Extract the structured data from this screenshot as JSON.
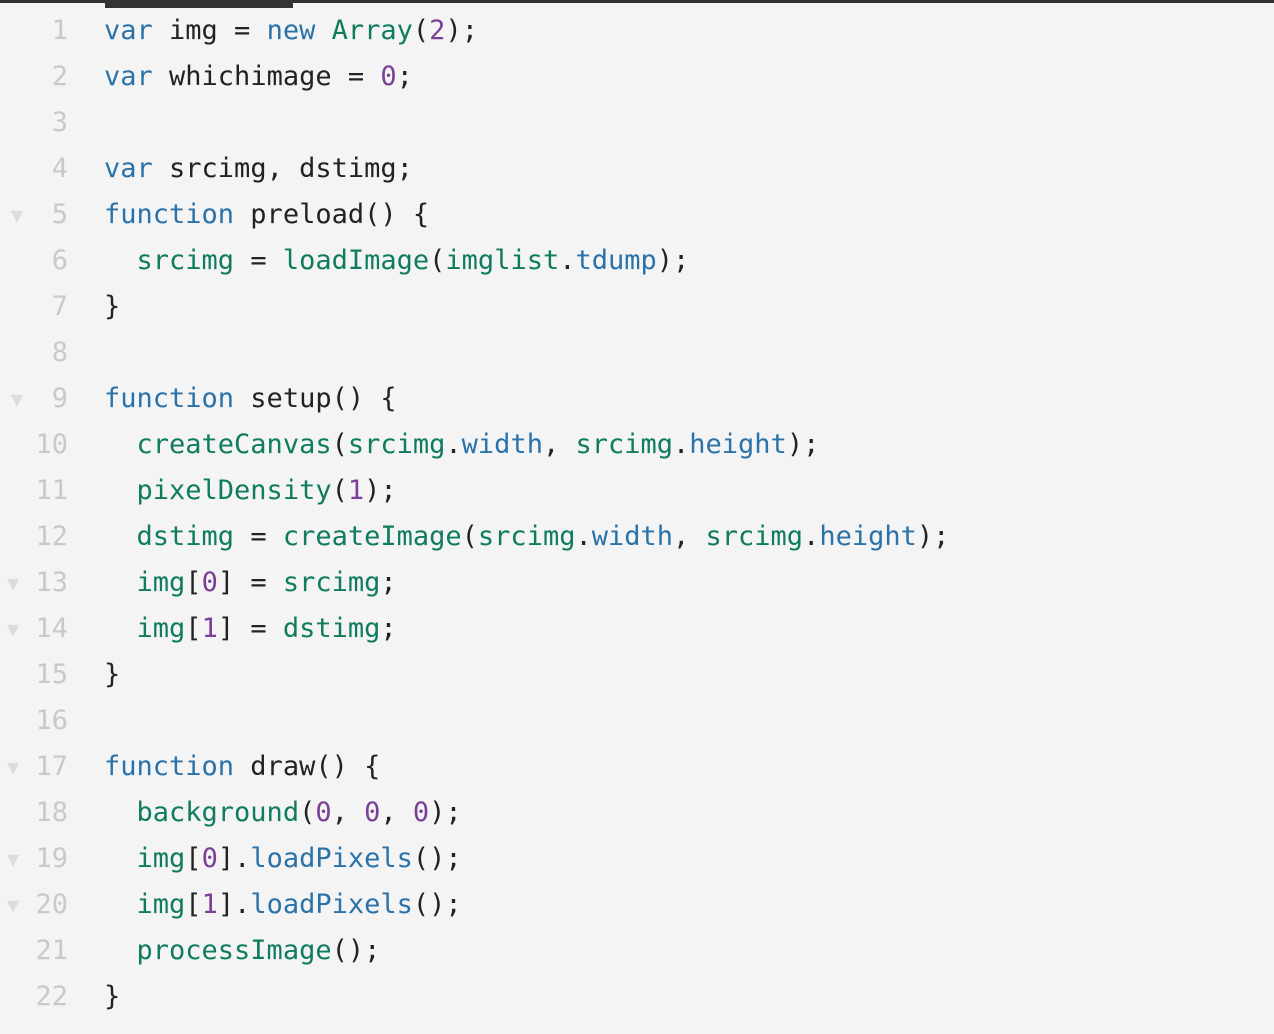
{
  "app": {
    "kind": "code-editor",
    "language": "javascript"
  },
  "colors": {
    "background": "#f4f4f4",
    "tab_bar": "#333333",
    "line_number": "#c9c9c9",
    "fold_arrow": "#dcdcdc",
    "keyword": "#2a72a8",
    "identifier": "#0f7b5f",
    "property": "#2a72a8",
    "number": "#7a3f96",
    "plain": "#222222"
  },
  "tabbar": {
    "active_tab_label": ""
  },
  "editor": {
    "first_visible_line": 1,
    "last_visible_line": 22,
    "lines": [
      {
        "number": "1",
        "fold": false,
        "tokens": [
          {
            "t": "var",
            "c": "kw"
          },
          {
            "t": " img = ",
            "c": "pl"
          },
          {
            "t": "new",
            "c": "kw"
          },
          {
            "t": " ",
            "c": "pl"
          },
          {
            "t": "Array",
            "c": "fn"
          },
          {
            "t": "(",
            "c": "pl"
          },
          {
            "t": "2",
            "c": "num"
          },
          {
            "t": ");",
            "c": "pl"
          }
        ]
      },
      {
        "number": "2",
        "fold": false,
        "tokens": [
          {
            "t": "var",
            "c": "kw"
          },
          {
            "t": " whichimage = ",
            "c": "pl"
          },
          {
            "t": "0",
            "c": "num"
          },
          {
            "t": ";",
            "c": "pl"
          }
        ]
      },
      {
        "number": "3",
        "fold": false,
        "tokens": []
      },
      {
        "number": "4",
        "fold": false,
        "tokens": [
          {
            "t": "var",
            "c": "kw"
          },
          {
            "t": " srcimg, dstimg;",
            "c": "pl"
          }
        ]
      },
      {
        "number": "5",
        "fold": true,
        "tokens": [
          {
            "t": "function",
            "c": "kw"
          },
          {
            "t": " preload() {",
            "c": "pl"
          }
        ]
      },
      {
        "number": "6",
        "fold": false,
        "tokens": [
          {
            "t": "  ",
            "c": "pl"
          },
          {
            "t": "srcimg",
            "c": "fn"
          },
          {
            "t": " = ",
            "c": "pl"
          },
          {
            "t": "loadImage",
            "c": "fn"
          },
          {
            "t": "(",
            "c": "pl"
          },
          {
            "t": "imglist",
            "c": "fn"
          },
          {
            "t": ".",
            "c": "pl"
          },
          {
            "t": "tdump",
            "c": "prop"
          },
          {
            "t": ");",
            "c": "pl"
          }
        ]
      },
      {
        "number": "7",
        "fold": false,
        "tokens": [
          {
            "t": "}",
            "c": "pl"
          }
        ]
      },
      {
        "number": "8",
        "fold": false,
        "tokens": []
      },
      {
        "number": "9",
        "fold": true,
        "tokens": [
          {
            "t": "function",
            "c": "kw"
          },
          {
            "t": " setup() {",
            "c": "pl"
          }
        ]
      },
      {
        "number": "10",
        "fold": false,
        "tokens": [
          {
            "t": "  ",
            "c": "pl"
          },
          {
            "t": "createCanvas",
            "c": "fn"
          },
          {
            "t": "(",
            "c": "pl"
          },
          {
            "t": "srcimg",
            "c": "fn"
          },
          {
            "t": ".",
            "c": "pl"
          },
          {
            "t": "width",
            "c": "prop"
          },
          {
            "t": ", ",
            "c": "pl"
          },
          {
            "t": "srcimg",
            "c": "fn"
          },
          {
            "t": ".",
            "c": "pl"
          },
          {
            "t": "height",
            "c": "prop"
          },
          {
            "t": ");",
            "c": "pl"
          }
        ]
      },
      {
        "number": "11",
        "fold": false,
        "tokens": [
          {
            "t": "  ",
            "c": "pl"
          },
          {
            "t": "pixelDensity",
            "c": "fn"
          },
          {
            "t": "(",
            "c": "pl"
          },
          {
            "t": "1",
            "c": "num"
          },
          {
            "t": ");",
            "c": "pl"
          }
        ]
      },
      {
        "number": "12",
        "fold": false,
        "tokens": [
          {
            "t": "  ",
            "c": "pl"
          },
          {
            "t": "dstimg",
            "c": "fn"
          },
          {
            "t": " = ",
            "c": "pl"
          },
          {
            "t": "createImage",
            "c": "fn"
          },
          {
            "t": "(",
            "c": "pl"
          },
          {
            "t": "srcimg",
            "c": "fn"
          },
          {
            "t": ".",
            "c": "pl"
          },
          {
            "t": "width",
            "c": "prop"
          },
          {
            "t": ", ",
            "c": "pl"
          },
          {
            "t": "srcimg",
            "c": "fn"
          },
          {
            "t": ".",
            "c": "pl"
          },
          {
            "t": "height",
            "c": "prop"
          },
          {
            "t": ");",
            "c": "pl"
          }
        ]
      },
      {
        "number": "13",
        "fold": true,
        "tokens": [
          {
            "t": "  ",
            "c": "pl"
          },
          {
            "t": "img",
            "c": "fn"
          },
          {
            "t": "[",
            "c": "pl"
          },
          {
            "t": "0",
            "c": "num"
          },
          {
            "t": "] = ",
            "c": "pl"
          },
          {
            "t": "srcimg",
            "c": "fn"
          },
          {
            "t": ";",
            "c": "pl"
          }
        ]
      },
      {
        "number": "14",
        "fold": true,
        "tokens": [
          {
            "t": "  ",
            "c": "pl"
          },
          {
            "t": "img",
            "c": "fn"
          },
          {
            "t": "[",
            "c": "pl"
          },
          {
            "t": "1",
            "c": "num"
          },
          {
            "t": "] = ",
            "c": "pl"
          },
          {
            "t": "dstimg",
            "c": "fn"
          },
          {
            "t": ";",
            "c": "pl"
          }
        ]
      },
      {
        "number": "15",
        "fold": false,
        "tokens": [
          {
            "t": "}",
            "c": "pl"
          }
        ]
      },
      {
        "number": "16",
        "fold": false,
        "tokens": []
      },
      {
        "number": "17",
        "fold": true,
        "tokens": [
          {
            "t": "function",
            "c": "kw"
          },
          {
            "t": " draw() {",
            "c": "pl"
          }
        ]
      },
      {
        "number": "18",
        "fold": false,
        "tokens": [
          {
            "t": "  ",
            "c": "pl"
          },
          {
            "t": "background",
            "c": "fn"
          },
          {
            "t": "(",
            "c": "pl"
          },
          {
            "t": "0",
            "c": "num"
          },
          {
            "t": ", ",
            "c": "pl"
          },
          {
            "t": "0",
            "c": "num"
          },
          {
            "t": ", ",
            "c": "pl"
          },
          {
            "t": "0",
            "c": "num"
          },
          {
            "t": ");",
            "c": "pl"
          }
        ]
      },
      {
        "number": "19",
        "fold": true,
        "tokens": [
          {
            "t": "  ",
            "c": "pl"
          },
          {
            "t": "img",
            "c": "fn"
          },
          {
            "t": "[",
            "c": "pl"
          },
          {
            "t": "0",
            "c": "num"
          },
          {
            "t": "].",
            "c": "pl"
          },
          {
            "t": "loadPixels",
            "c": "prop"
          },
          {
            "t": "();",
            "c": "pl"
          }
        ]
      },
      {
        "number": "20",
        "fold": true,
        "tokens": [
          {
            "t": "  ",
            "c": "pl"
          },
          {
            "t": "img",
            "c": "fn"
          },
          {
            "t": "[",
            "c": "pl"
          },
          {
            "t": "1",
            "c": "num"
          },
          {
            "t": "].",
            "c": "pl"
          },
          {
            "t": "loadPixels",
            "c": "prop"
          },
          {
            "t": "();",
            "c": "pl"
          }
        ]
      },
      {
        "number": "21",
        "fold": false,
        "tokens": [
          {
            "t": "  ",
            "c": "pl"
          },
          {
            "t": "processImage",
            "c": "fn"
          },
          {
            "t": "();",
            "c": "pl"
          }
        ]
      },
      {
        "number": "22",
        "fold": false,
        "tokens": [
          {
            "t": "}",
            "c": "pl"
          }
        ]
      }
    ]
  },
  "icons": {
    "fold_collapse": "▼"
  }
}
